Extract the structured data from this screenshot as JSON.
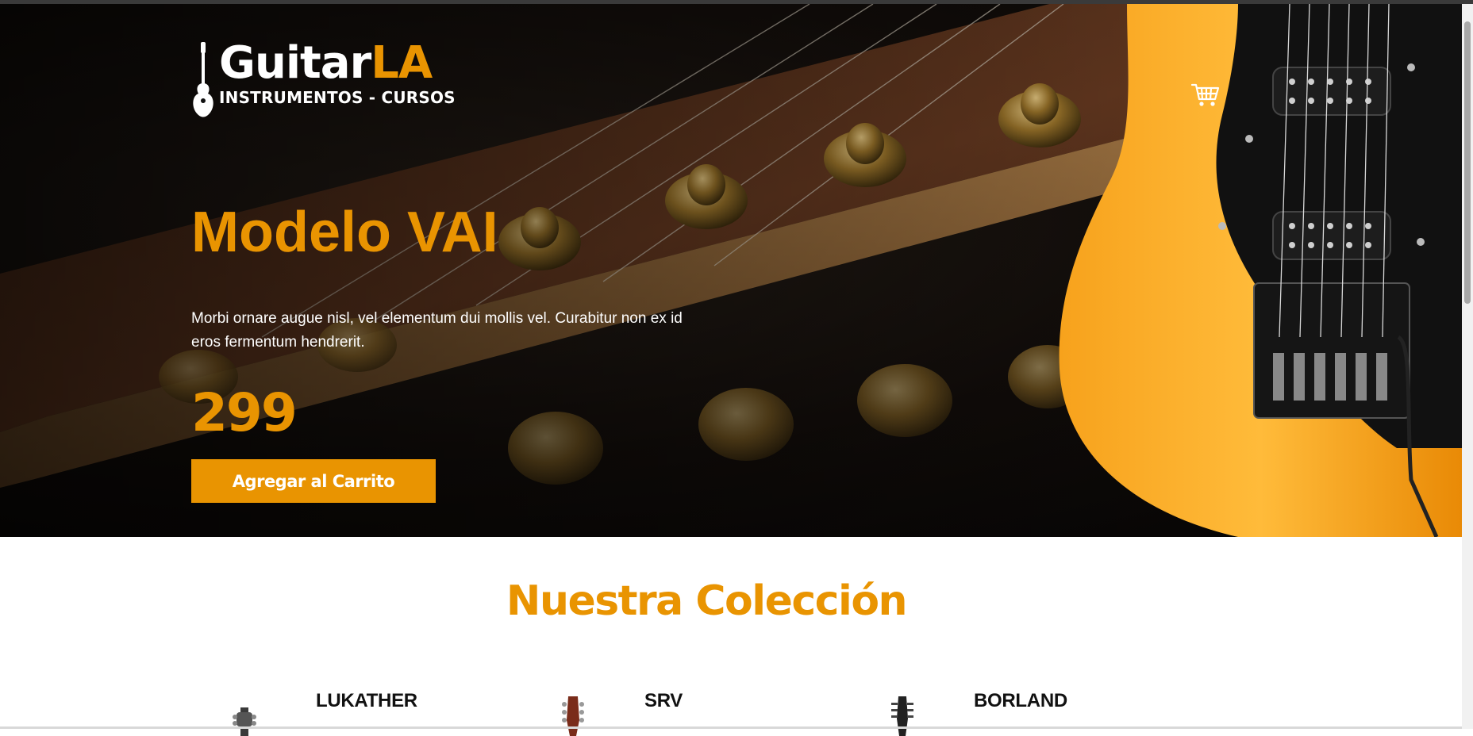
{
  "brand": {
    "word1": "Guitar",
    "word2": "LA",
    "tagline": "INSTRUMENTOS - CURSOS"
  },
  "hero": {
    "model": "Modelo VAI",
    "description": "Morbi ornare augue nisl, vel elementum dui mollis vel. Curabitur non ex id eros fermentum hendrerit.",
    "price": "299",
    "add_to_cart_label": "Agregar al Carrito"
  },
  "collection": {
    "title": "Nuestra Colección",
    "products": [
      {
        "name": "LUKATHER",
        "icon": "guitar-headstock-icon"
      },
      {
        "name": "SRV",
        "icon": "guitar-headstock-icon"
      },
      {
        "name": "BORLAND",
        "icon": "guitar-headstock-icon"
      }
    ]
  },
  "colors": {
    "accent": "#e99401",
    "dark": "#111111",
    "white": "#ffffff"
  },
  "icons": {
    "cart": "shopping-cart-icon",
    "logo": "guitar-logo-icon"
  }
}
